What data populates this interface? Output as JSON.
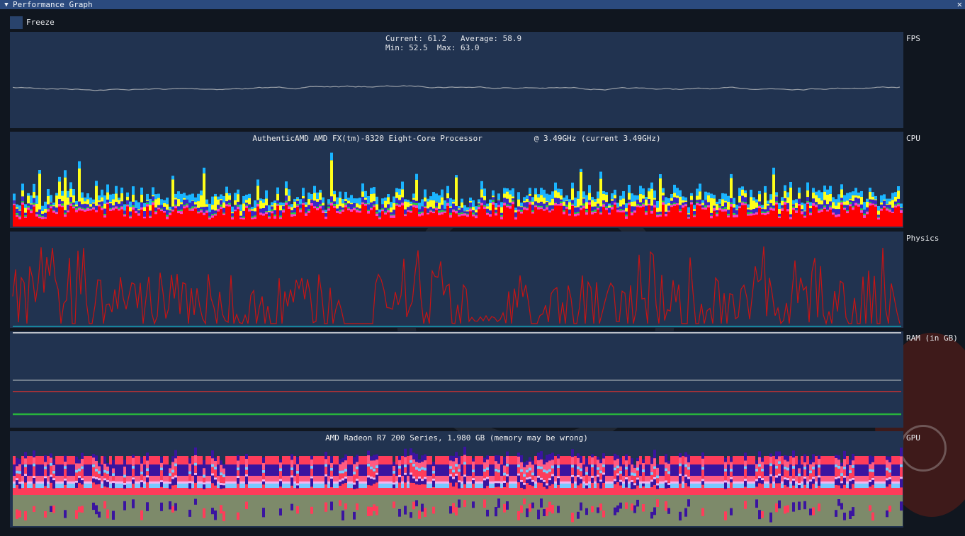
{
  "window": {
    "title": "Performance Graph",
    "collapse_icon": "triangle-down-icon",
    "close_icon": "close-icon"
  },
  "freeze": {
    "label": "Freeze",
    "checked": false
  },
  "fps": {
    "label": "FPS",
    "current_label": "Current:",
    "current": "61.2",
    "average_label": "Average:",
    "average": "58.9",
    "min_label": "Min:",
    "min": "52.5",
    "max_label": "Max:",
    "max": "63.0"
  },
  "cpu": {
    "label": "CPU",
    "processor": "AuthenticAMD AMD FX(tm)-8320 Eight-Core Processor",
    "clock": "@ 3.49GHz (current 3.49GHz)",
    "layer_colors": [
      "#ff0000",
      "#ff3cc8",
      "#1ab4ff",
      "#ffff1a",
      "#3a28c8",
      "#28d23c"
    ]
  },
  "physics": {
    "label": "Physics",
    "line_color": "#c81414",
    "baseline_color": "#14a0b4"
  },
  "ram": {
    "label": "RAM (in GB)",
    "line_colors": [
      "#f0f0f0",
      "#8c96a0",
      "#c83232",
      "#28b43c"
    ]
  },
  "gpu": {
    "label": "GPU",
    "adapter": "AMD Radeon R7 200 Series, 1.980 GB (memory may be wrong)",
    "layer_colors": [
      "#7d8a6a",
      "#ff3c5a",
      "#3a14a0",
      "#78c8ff",
      "#f0b4f0",
      "#ff5a82"
    ]
  }
}
